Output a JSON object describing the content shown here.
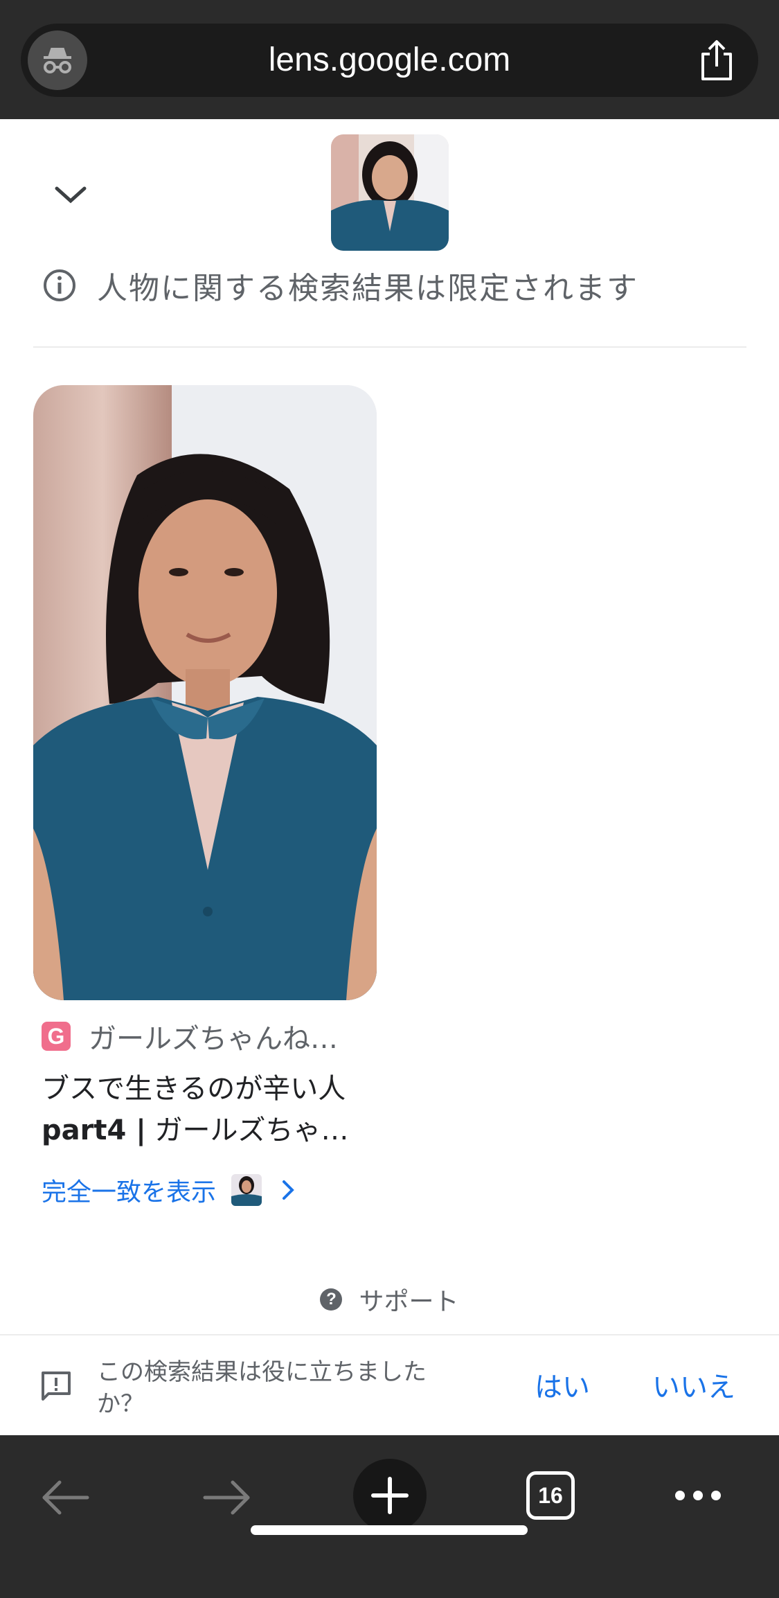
{
  "browser": {
    "url": "lens.google.com",
    "icons": {
      "left": "incognito-icon",
      "right": "share-icon"
    }
  },
  "lens": {
    "collapse_icon": "chevron-down-icon",
    "notice": "人物に関する検索結果は限定されます"
  },
  "result": {
    "source_favicon": "G",
    "source_name": "ガールズちゃんね…",
    "title_line1": "ブスで生きるのが辛い人",
    "title_line2_bold": "part4 |",
    "title_line2_rest": " ガールズちゃ…",
    "exact_match_label": "完全一致を表示"
  },
  "support": {
    "label": "サポート"
  },
  "feedback": {
    "question": "この検索結果は役に立ちましたか？",
    "yes": "はい",
    "no": "いいえ"
  },
  "toolbar": {
    "tab_count": "16",
    "icons": [
      "back-arrow-icon",
      "forward-arrow-icon",
      "new-tab-plus-icon",
      "tab-switcher-icon",
      "more-icon"
    ]
  },
  "colors": {
    "bar_bg": "#2b2b2b",
    "link_blue": "#1a73e8",
    "favicon_pink": "#f06e8c",
    "shirt_teal": "#1f5a7a"
  }
}
